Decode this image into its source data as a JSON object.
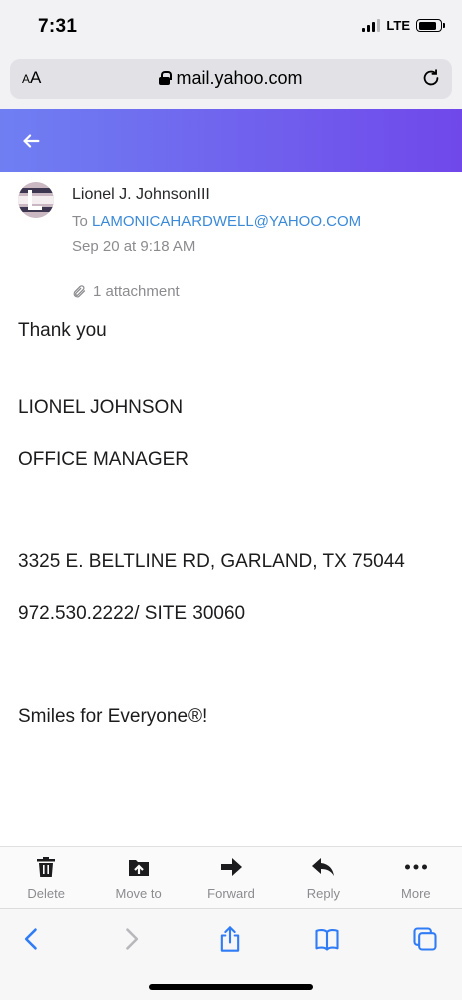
{
  "status": {
    "time": "7:31",
    "network": "LTE"
  },
  "browser": {
    "text_size_label_small": "A",
    "text_size_label_large": "A",
    "url": "mail.yahoo.com"
  },
  "message": {
    "sender": "Lionel J. JohnsonIII",
    "to_label": "To",
    "recipient": "LAMONICAHARDWELL@YAHOO.COM",
    "date": "Sep 20 at 9:18 AM",
    "attachments": "1 attachment",
    "body": [
      "Thank you",
      "LIONEL JOHNSON",
      "OFFICE MANAGER",
      "3325 E. BELTLINE RD, GARLAND, TX 75044",
      "972.530.2222/ SITE 30060",
      "Smiles for Everyone®!"
    ]
  },
  "toolbar": {
    "delete": "Delete",
    "move_to": "Move to",
    "forward": "Forward",
    "reply": "Reply",
    "more": "More"
  },
  "colors": {
    "header_gradient_start": "#6f7ff2",
    "header_gradient_end": "#7048ea",
    "link": "#3a8ad9",
    "safari_blue": "#2f7cf6"
  },
  "icons": [
    "lock-icon",
    "reload-icon",
    "back-arrow-icon",
    "paperclip-icon",
    "trash-icon",
    "move-folder-icon",
    "forward-arrow-icon",
    "reply-arrow-icon",
    "more-dots-icon",
    "safari-back-icon",
    "safari-forward-icon",
    "share-icon",
    "bookmarks-icon",
    "tabs-icon"
  ]
}
